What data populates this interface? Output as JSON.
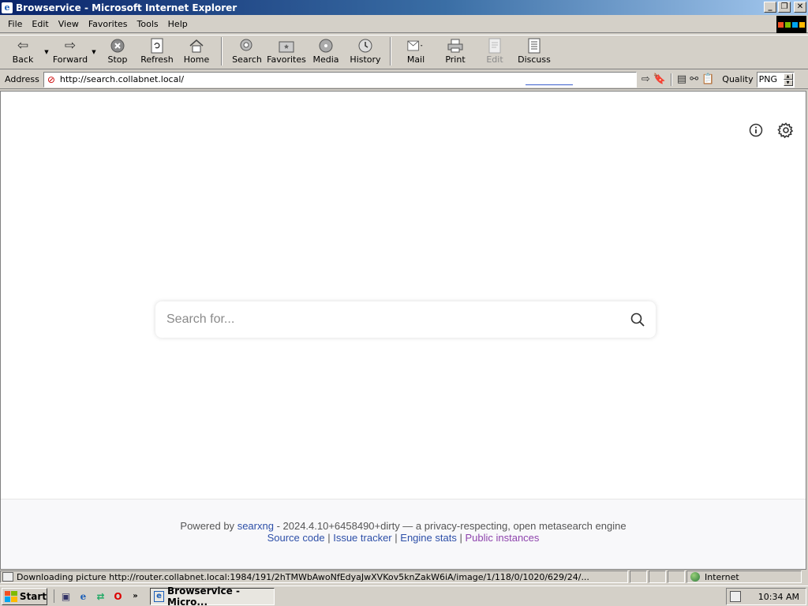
{
  "window": {
    "title": "Browservice - Microsoft Internet Explorer",
    "controls": [
      "minimize",
      "restore",
      "close"
    ]
  },
  "menu": {
    "items": [
      {
        "label": "File",
        "accel": "F"
      },
      {
        "label": "Edit",
        "accel": "E"
      },
      {
        "label": "View",
        "accel": "V"
      },
      {
        "label": "Favorites",
        "accel": "a"
      },
      {
        "label": "Tools",
        "accel": "T"
      },
      {
        "label": "Help",
        "accel": "H"
      }
    ]
  },
  "toolbar": {
    "back": "Back",
    "forward": "Forward",
    "stop": "Stop",
    "refresh": "Refresh",
    "home": "Home",
    "search": "Search",
    "favorites": "Favorites",
    "media": "Media",
    "history": "History",
    "mail": "Mail",
    "print": "Print",
    "edit": "Edit",
    "discuss": "Discuss"
  },
  "address": {
    "label": "Address",
    "url": "http://search.collabnet.local/",
    "quality_label": "Quality",
    "quality_value": "PNG"
  },
  "page": {
    "search_placeholder": "Search for...",
    "footer": {
      "powered_by": "Powered by",
      "engine": "searxng",
      "version_text": "- 2024.4.10+6458490+dirty — a privacy-respecting, open metasearch engine",
      "source_code": "Source code",
      "issue_tracker": "Issue tracker",
      "engine_stats": "Engine stats",
      "public_instances": "Public instances",
      "separator": "|"
    }
  },
  "status": {
    "message": "Downloading picture http://router.collabnet.local:1984/191/2hTMWbAwoNfEdyaJwXVKov5knZakW6iA/image/1/118/0/1020/629/24/...",
    "zone": "Internet"
  },
  "taskbar": {
    "start": "Start",
    "task": "Browservice - Micro...",
    "clock": "10:34 AM"
  },
  "colors": {
    "title_gradient_start": "#0a246a",
    "link": "#2d4fa8",
    "visited_link": "#8e44ad"
  }
}
